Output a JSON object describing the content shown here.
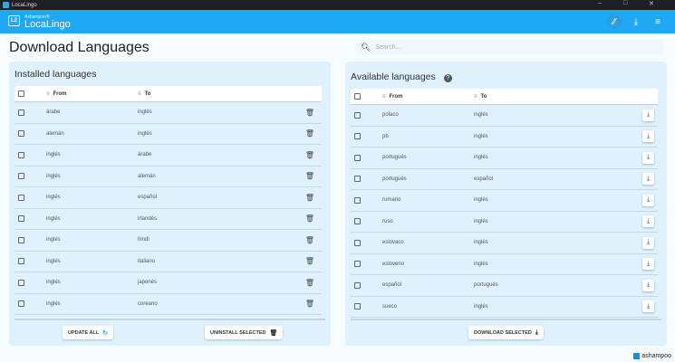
{
  "window": {
    "title": "LocaLingo",
    "controls": [
      "–",
      "□",
      "✕"
    ]
  },
  "header": {
    "brand_small": "Ashampoo®",
    "brand": "LocaLingo",
    "logo": "L2",
    "icons": [
      "no-translate-icon",
      "download-icon",
      "menu-icon"
    ]
  },
  "page": {
    "title": "Download Languages"
  },
  "search": {
    "placeholder": "Search..."
  },
  "installed": {
    "title": "Installed languages",
    "columns": {
      "from": "From",
      "to": "To"
    },
    "rows": [
      {
        "from": "árabe",
        "to": "inglés"
      },
      {
        "from": "alemán",
        "to": "inglés"
      },
      {
        "from": "inglés",
        "to": "árabe"
      },
      {
        "from": "inglés",
        "to": "alemán"
      },
      {
        "from": "inglés",
        "to": "español"
      },
      {
        "from": "inglés",
        "to": "irlandés"
      },
      {
        "from": "inglés",
        "to": "hindi"
      },
      {
        "from": "inglés",
        "to": "italiano"
      },
      {
        "from": "inglés",
        "to": "japonés"
      },
      {
        "from": "inglés",
        "to": "coreano"
      }
    ],
    "update_all": "UPDATE ALL",
    "uninstall_selected": "UNINSTALL SELECTED"
  },
  "available": {
    "title": "Available languages",
    "columns": {
      "from": "From",
      "to": "To"
    },
    "rows": [
      {
        "from": "polaco",
        "to": "inglés"
      },
      {
        "from": "pb",
        "to": "inglés"
      },
      {
        "from": "portugués",
        "to": "inglés"
      },
      {
        "from": "portugués",
        "to": "español"
      },
      {
        "from": "rumano",
        "to": "inglés"
      },
      {
        "from": "ruso",
        "to": "inglés"
      },
      {
        "from": "eslovaco",
        "to": "inglés"
      },
      {
        "from": "esloveno",
        "to": "inglés"
      },
      {
        "from": "español",
        "to": "portugués"
      },
      {
        "from": "sueco",
        "to": "inglés"
      }
    ],
    "download_selected": "DOWNLOAD SELECTED"
  },
  "footer": {
    "brand": "ashampoo"
  },
  "colors": {
    "accent": "#1fa8f3",
    "panel": "#dff1fd"
  }
}
